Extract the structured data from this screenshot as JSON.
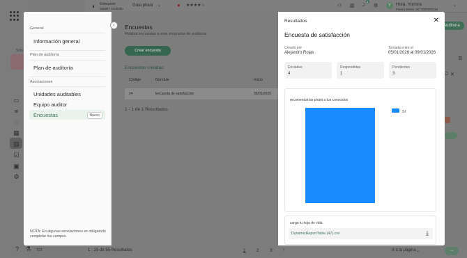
{
  "topbar": {
    "company_name": "Enterprise",
    "company_sub": "16082 / Orebodo",
    "guide": "Guía pirani",
    "rating_stars": 4,
    "notification_count": "1",
    "user_greeting": "Hola, Yomira",
    "user_sub": "Pirani | Demo | ID: 0000000419",
    "avatar_letter": "Y"
  },
  "background": {
    "side_label": "Sólo",
    "auditoria_button": "Auditoria",
    "results_text": "1 - 25 de 55 Resultados",
    "pages": [
      "1",
      "2",
      "3"
    ],
    "goto_label": "Ir a la página"
  },
  "left_panel": {
    "section_general": "General",
    "item_info": "Información general",
    "section_plan": "Plan de auditoría",
    "item_plan": "Plan de auditoría",
    "section_assoc": "Asociaciones",
    "item_units": "Unidades auditables",
    "item_team": "Equipo auditor",
    "item_surveys": "Encuestas",
    "badge_new": "Nuevo",
    "note": "NOTA: En algunas asociaciones es obligatorio completar los campos."
  },
  "middle": {
    "title": "Encuestas",
    "subtitle": "Realiza encuestas a este programa de auditoría",
    "create_button": "Crear encuesta",
    "created_label": "Encuestas creadas:",
    "columns": [
      "Código",
      "Nombre",
      "Inicio"
    ],
    "row": {
      "code": "24",
      "name": "Encuesta de satisfacción",
      "start": "05/01/2026"
    },
    "footer": "1 - 1 de 1 Resultados"
  },
  "results": {
    "panel_title": "Resultados",
    "survey_title": "Encuesta de satisfacción",
    "created_by_label": "Creado por",
    "created_by": "Alejandro Rojas",
    "taken_label": "Tomada entre el",
    "taken_range": "05/01/2026 al 09/01/2026",
    "sent_label": "Enviadas",
    "sent": "4",
    "answered_label": "Respondidas",
    "answered": "1",
    "pending_label": "Pendientes",
    "pending": "3",
    "upload_label": "carga tu hoja de vida",
    "file_name": "DynamicReportTable (47).csv"
  },
  "chart_data": {
    "type": "bar",
    "title": "recomendarías pirani a tus conocidos",
    "categories": [
      "Sí"
    ],
    "series": [
      {
        "name": "Sí",
        "values": [
          1
        ]
      }
    ],
    "ylim": [
      0,
      1
    ],
    "legend": "top-right",
    "grid": false,
    "color": "#1a8cff"
  }
}
